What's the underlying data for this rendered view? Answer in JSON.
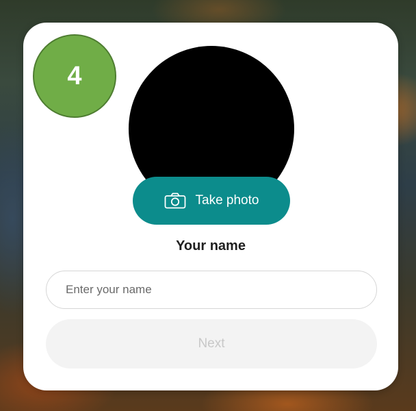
{
  "step_badge": {
    "number": "4",
    "color": "#70ad47"
  },
  "profile": {
    "avatar_color": "#000000",
    "take_photo_label": "Take photo",
    "take_photo_icon": "camera-icon",
    "accent_color": "#0c8c8c"
  },
  "name_form": {
    "label": "Your name",
    "placeholder": "Enter your name",
    "value": "",
    "next_label": "Next",
    "next_enabled": false
  }
}
